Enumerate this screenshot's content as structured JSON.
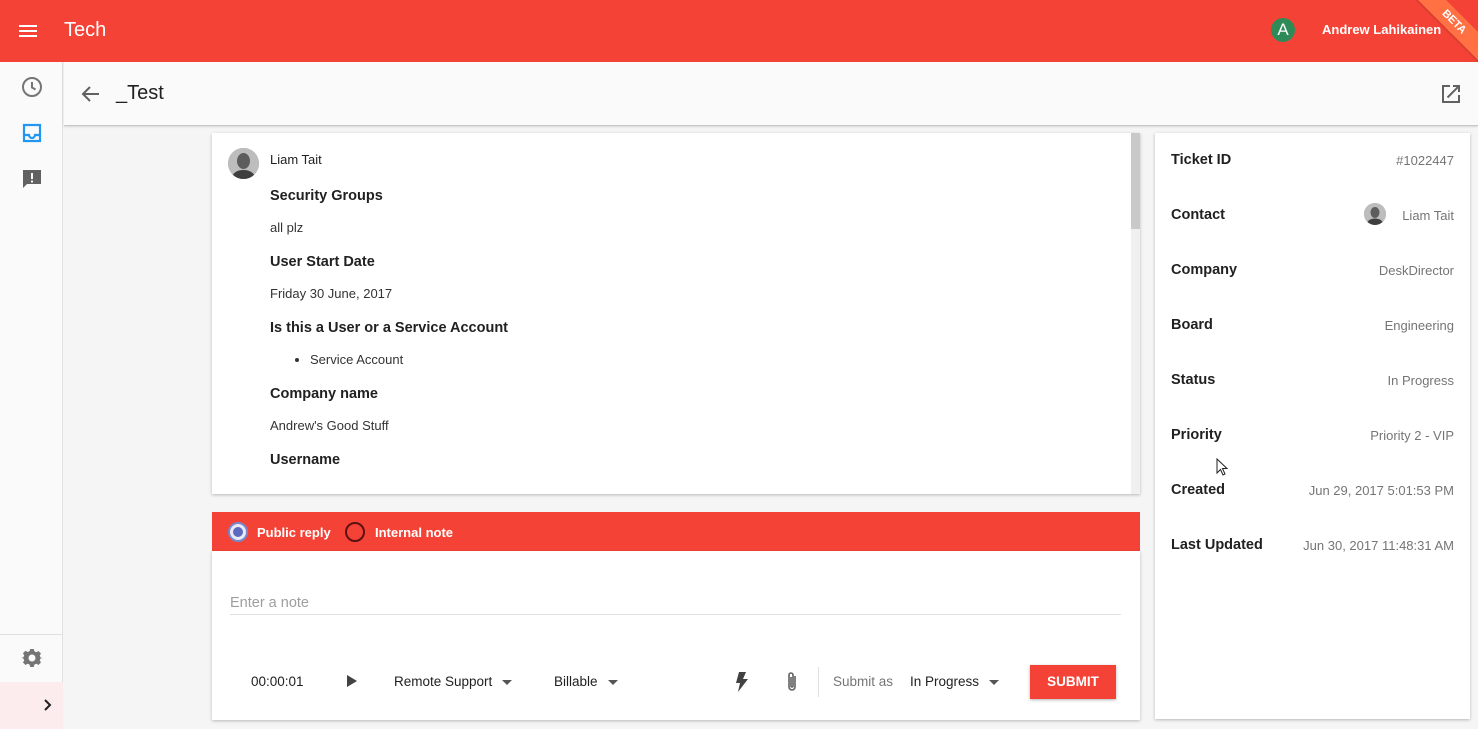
{
  "app": {
    "title": "Tech",
    "user_name": "Andrew Lahikainen",
    "user_initial": "A",
    "beta_label": "BETA",
    "accent": "#f44336"
  },
  "ticket": {
    "title": "_Test"
  },
  "message": {
    "author": "Liam Tait",
    "fields": [
      {
        "heading": "Security Groups",
        "value": "all plz"
      },
      {
        "heading": "User Start Date",
        "value": "Friday 30 June, 2017"
      },
      {
        "heading": "Is this a User or a Service Account",
        "bullet": "Service Account"
      },
      {
        "heading": "Company name",
        "value": "Andrew's Good Stuff"
      },
      {
        "heading": "Username"
      }
    ]
  },
  "reply": {
    "public_label": "Public reply",
    "internal_label": "Internal note",
    "note_placeholder": "Enter a note",
    "timer": "00:00:01",
    "work_type": "Remote Support",
    "billing": "Billable",
    "submit_as_label": "Submit as",
    "submit_status": "In Progress",
    "submit_label": "SUBMIT"
  },
  "details": [
    {
      "label": "Ticket ID",
      "value": "#1022447"
    },
    {
      "label": "Contact",
      "value": "Liam Tait"
    },
    {
      "label": "Company",
      "value": "DeskDirector"
    },
    {
      "label": "Board",
      "value": "Engineering"
    },
    {
      "label": "Status",
      "value": "In Progress"
    },
    {
      "label": "Priority",
      "value": "Priority 2 - VIP"
    },
    {
      "label": "Created",
      "value": "Jun 29, 2017 5:01:53 PM"
    },
    {
      "label": "Last Updated",
      "value": "Jun 30, 2017 11:48:31 AM"
    }
  ]
}
